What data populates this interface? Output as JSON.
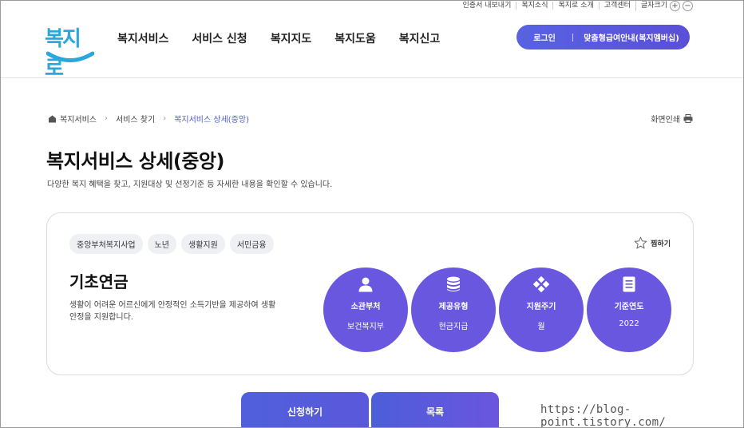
{
  "utility": {
    "items": [
      "인증서 내보내기",
      "복지소식",
      "복지로 소개",
      "고객센터"
    ],
    "font_size_label": "글자크기",
    "plus": "+",
    "minus": "−"
  },
  "header": {
    "logo_text": "복지로",
    "nav": [
      "복지서비스",
      "서비스 신청",
      "복지지도",
      "복지도움",
      "복지신고"
    ],
    "login_label": "로그인",
    "guide_label": "맞춤형급여안내(복지멤버십)",
    "brand_color": "#5b5fe0"
  },
  "breadcrumb": {
    "items": [
      "복지서비스",
      "서비스 찾기",
      "복지서비스 상세(중앙)"
    ]
  },
  "print_label": "화면인쇄",
  "page": {
    "title": "복지서비스 상세(중앙)",
    "description": "다양한 복지 혜택을 찾고, 지원대상 및 선정기준 등 자세한 내용을 확인할 수 있습니다."
  },
  "service": {
    "tags": [
      "중앙부처복지사업",
      "노년",
      "생활지원",
      "서민금융"
    ],
    "favorite_label": "찜하기",
    "title": "기초연금",
    "description": "생활이 어려운 어르신에게 안정적인 소득기반을 제공하여 생활안정을 지원합니다.",
    "info": [
      {
        "label": "소관부처",
        "value": "보건복지부",
        "icon": "person-icon"
      },
      {
        "label": "제공유형",
        "value": "현금지급",
        "icon": "database-icon"
      },
      {
        "label": "지원주기",
        "value": "월",
        "icon": "dots-icon"
      },
      {
        "label": "기준연도",
        "value": "2022",
        "icon": "document-icon"
      }
    ]
  },
  "buttons": {
    "apply": "신청하기",
    "list": "목록"
  },
  "watermark": "https://blog-point.tistory.com/"
}
